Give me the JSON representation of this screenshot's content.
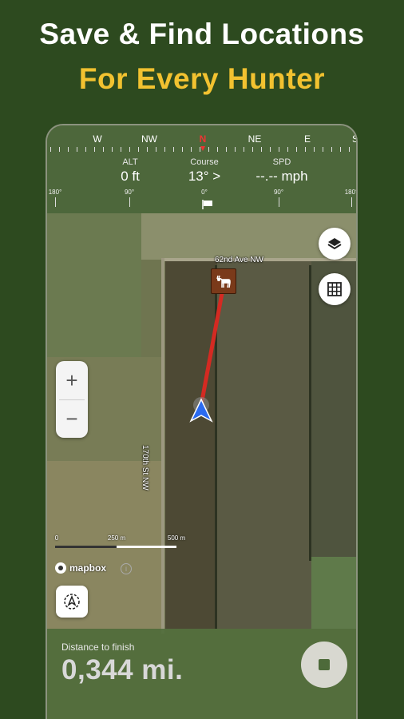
{
  "promo": {
    "line1": "Save & Find Locations",
    "line2": "For Every Hunter",
    "accent_color": "#f2c230"
  },
  "compass": {
    "directions": [
      "W",
      "NW",
      "N",
      "NE",
      "E",
      "S"
    ],
    "alt": {
      "label": "ALT",
      "value": "0 ft"
    },
    "course": {
      "label": "Course",
      "value": "13° >"
    },
    "spd": {
      "label": "SPD",
      "value": "--.-- mph"
    },
    "degrees": [
      "180°",
      "90°",
      "0°",
      "90°",
      "180°"
    ]
  },
  "map": {
    "road_h": "62nd Ave NW",
    "road_v": "170th St NW",
    "scale": {
      "start": "0",
      "mid": "250 m",
      "end": "500 m"
    },
    "attribution": "mapbox",
    "info": "i",
    "target_icon": "deer-icon",
    "user_icon": "navigation-arrow-icon"
  },
  "controls": {
    "layers": "layers-icon",
    "grid": "grid-icon",
    "zoom_in": "+",
    "zoom_out": "−",
    "locate": "compass-locate-icon"
  },
  "panel": {
    "distance_label": "Distance to finish",
    "distance_value": "0,344 mi.",
    "stop": "stop-icon"
  },
  "colors": {
    "background": "#2d4a1f",
    "route": "#d42a22",
    "user_arrow": "#2b6bf0"
  }
}
